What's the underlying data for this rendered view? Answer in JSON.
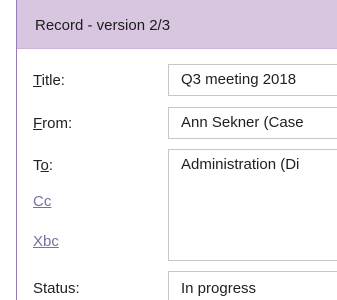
{
  "window": {
    "title": "Record - version 2/3"
  },
  "form": {
    "title": {
      "label_mnemonic": "T",
      "label_rest": "itle:",
      "value": "Q3 meeting 2018"
    },
    "from": {
      "label_mnemonic": "F",
      "label_rest": "rom:",
      "value": "Ann Sekner (Case"
    },
    "to": {
      "label_prefix": "T",
      "label_mnemonic": "o",
      "label_suffix": ":",
      "value": "Administration (Di"
    },
    "cc": {
      "label": "Cc"
    },
    "xbc": {
      "label": "Xbc"
    },
    "status": {
      "label": "Status:",
      "value": "In progress"
    }
  },
  "colors": {
    "titlebar": "#d8c6e1",
    "accent_border": "#9b7ab9",
    "link_label": "#7a6ea0",
    "field_border": "#c7c7c7"
  }
}
